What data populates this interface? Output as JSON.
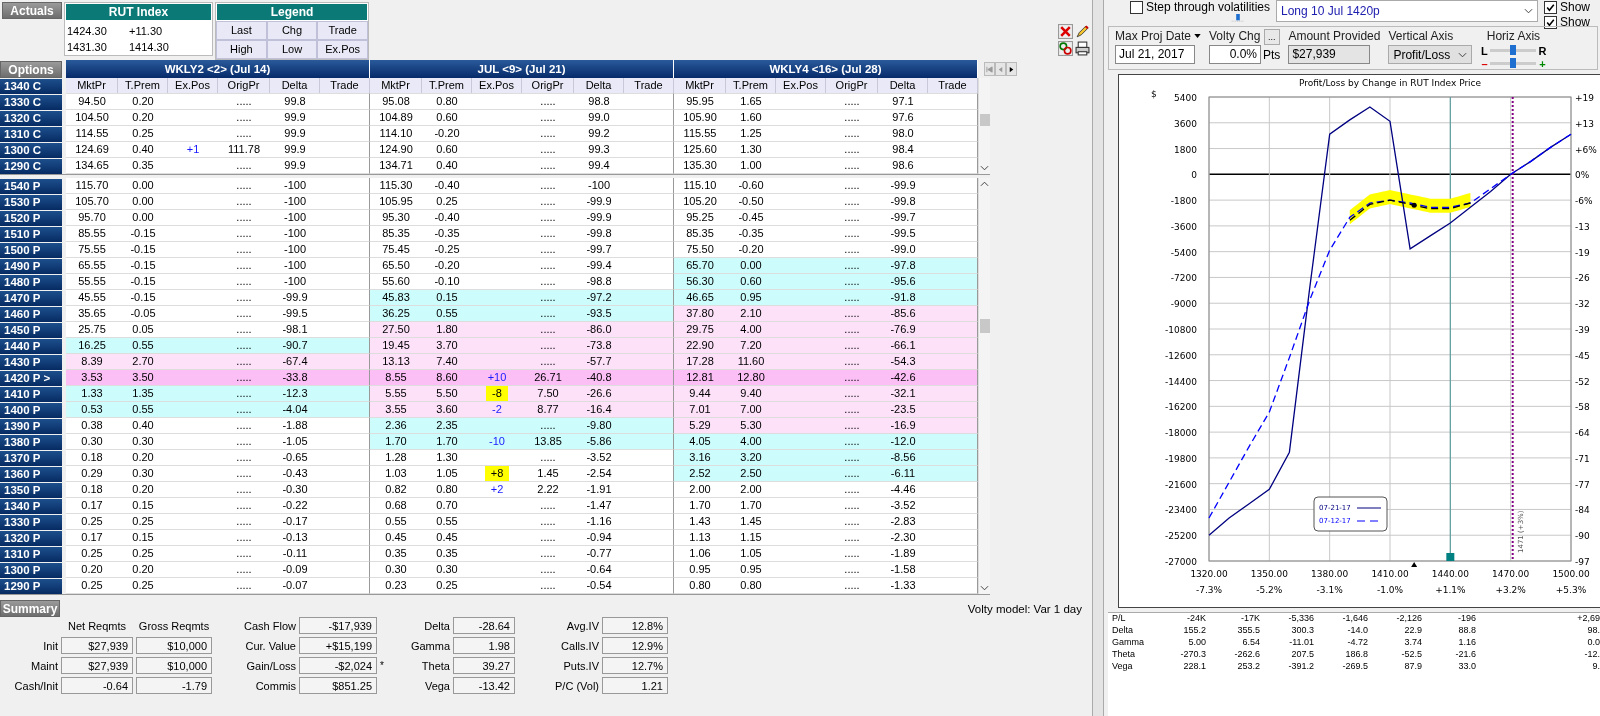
{
  "top_bar": {
    "actuals_button": "Actuals",
    "index": {
      "title": "RUT Index",
      "values": [
        "1424.30",
        "+11.30",
        "1431.30",
        "1414.30"
      ]
    },
    "legend": {
      "title": "Legend",
      "items": [
        "Last",
        "Chg",
        "Trade",
        "High",
        "Low",
        "Ex.Pos"
      ]
    }
  },
  "options_table": {
    "button": "Options",
    "groups": [
      {
        "title": "WKLY2 <2> (Jul 14)",
        "columns": [
          "MktPr",
          "T.Prem",
          "Ex.Pos",
          "OrigPr",
          "Delta",
          "Trade"
        ]
      },
      {
        "title": "JUL <9> (Jul 21)",
        "columns": [
          "MktPr",
          "T.Prem",
          "Ex.Pos",
          "OrigPr",
          "Delta",
          "Trade"
        ]
      },
      {
        "title": "WKLY4 <16> (Jul 28)",
        "columns": [
          "MktPr",
          "T.Prem",
          "Ex.Pos",
          "OrigPr",
          "Delta",
          "Trade"
        ]
      }
    ],
    "header_strike": "1340 C",
    "calls": [
      {
        "strike": "1330 C",
        "groups": [
          {
            "mkt": "94.50",
            "tp": "0.20",
            "orig": ".....",
            "delta": "99.8",
            "color": "#ffffff"
          },
          {
            "mkt": "95.08",
            "tp": "0.80",
            "orig": ".....",
            "delta": "98.8",
            "color": "#ffffff"
          },
          {
            "mkt": "95.95",
            "tp": "1.65",
            "orig": ".....",
            "delta": "97.1",
            "color": "#ffffff"
          }
        ]
      },
      {
        "strike": "1320 C",
        "groups": [
          {
            "mkt": "104.50",
            "tp": "0.20",
            "orig": ".....",
            "delta": "99.9",
            "color": "#ffffff"
          },
          {
            "mkt": "104.89",
            "tp": "0.60",
            "orig": ".....",
            "delta": "99.0",
            "color": "#ffffff"
          },
          {
            "mkt": "105.90",
            "tp": "1.60",
            "orig": ".....",
            "delta": "97.6",
            "color": "#ffffff"
          }
        ]
      },
      {
        "strike": "1310 C",
        "groups": [
          {
            "mkt": "114.55",
            "tp": "0.25",
            "orig": ".....",
            "delta": "99.9",
            "color": "#ffffff"
          },
          {
            "mkt": "114.10",
            "tp": "-0.20",
            "orig": ".....",
            "delta": "99.2",
            "color": "#ffffff"
          },
          {
            "mkt": "115.55",
            "tp": "1.25",
            "orig": ".....",
            "delta": "98.0",
            "color": "#ffffff"
          }
        ]
      },
      {
        "strike": "1300 C",
        "groups": [
          {
            "mkt": "124.69",
            "tp": "0.40",
            "ex": "+1",
            "marked": false,
            "orig": "111.78",
            "delta": "99.9",
            "color": "#ffffff"
          },
          {
            "mkt": "124.90",
            "tp": "0.60",
            "orig": ".....",
            "delta": "99.3",
            "color": "#ffffff"
          },
          {
            "mkt": "125.60",
            "tp": "1.30",
            "orig": ".....",
            "delta": "98.4",
            "color": "#ffffff"
          }
        ]
      },
      {
        "strike": "1290 C",
        "groups": [
          {
            "mkt": "134.65",
            "tp": "0.35",
            "orig": ".....",
            "delta": "99.9",
            "color": "#ffffff"
          },
          {
            "mkt": "134.71",
            "tp": "0.40",
            "orig": ".....",
            "delta": "99.4",
            "color": "#ffffff"
          },
          {
            "mkt": "135.30",
            "tp": "1.00",
            "orig": ".....",
            "delta": "98.6",
            "color": "#ffffff"
          }
        ]
      }
    ],
    "puts": [
      {
        "strike": "1540 P",
        "groups": [
          {
            "mkt": "115.70",
            "tp": "0.00",
            "orig": ".....",
            "delta": "-100",
            "color": "#ffffff"
          },
          {
            "mkt": "115.30",
            "tp": "-0.40",
            "orig": ".....",
            "delta": "-100",
            "color": "#ffffff"
          },
          {
            "mkt": "115.10",
            "tp": "-0.60",
            "orig": ".....",
            "delta": "-99.9",
            "color": "#ffffff"
          }
        ]
      },
      {
        "strike": "1530 P",
        "groups": [
          {
            "mkt": "105.70",
            "tp": "0.00",
            "orig": ".....",
            "delta": "-100",
            "color": "#ffffff"
          },
          {
            "mkt": "105.95",
            "tp": "0.25",
            "orig": ".....",
            "delta": "-99.9",
            "color": "#ffffff"
          },
          {
            "mkt": "105.20",
            "tp": "-0.50",
            "orig": ".....",
            "delta": "-99.8",
            "color": "#ffffff"
          }
        ]
      },
      {
        "strike": "1520 P",
        "groups": [
          {
            "mkt": "95.70",
            "tp": "0.00",
            "orig": ".....",
            "delta": "-100",
            "color": "#ffffff"
          },
          {
            "mkt": "95.30",
            "tp": "-0.40",
            "orig": ".....",
            "delta": "-99.9",
            "color": "#ffffff"
          },
          {
            "mkt": "95.25",
            "tp": "-0.45",
            "orig": ".....",
            "delta": "-99.7",
            "color": "#ffffff"
          }
        ]
      },
      {
        "strike": "1510 P",
        "groups": [
          {
            "mkt": "85.55",
            "tp": "-0.15",
            "orig": ".....",
            "delta": "-100",
            "color": "#ffffff"
          },
          {
            "mkt": "85.35",
            "tp": "-0.35",
            "orig": ".....",
            "delta": "-99.8",
            "color": "#ffffff"
          },
          {
            "mkt": "85.35",
            "tp": "-0.35",
            "orig": ".....",
            "delta": "-99.5",
            "color": "#ffffff"
          }
        ]
      },
      {
        "strike": "1500 P",
        "groups": [
          {
            "mkt": "75.55",
            "tp": "-0.15",
            "orig": ".....",
            "delta": "-100",
            "color": "#ffffff"
          },
          {
            "mkt": "75.45",
            "tp": "-0.25",
            "orig": ".....",
            "delta": "-99.7",
            "color": "#ffffff"
          },
          {
            "mkt": "75.50",
            "tp": "-0.20",
            "orig": ".....",
            "delta": "-99.0",
            "color": "#ffffff"
          }
        ]
      },
      {
        "strike": "1490 P",
        "groups": [
          {
            "mkt": "65.55",
            "tp": "-0.15",
            "orig": ".....",
            "delta": "-100",
            "color": "#ffffff"
          },
          {
            "mkt": "65.50",
            "tp": "-0.20",
            "orig": ".....",
            "delta": "-99.4",
            "color": "#ffffff"
          },
          {
            "mkt": "65.70",
            "tp": "0.00",
            "orig": ".....",
            "delta": "-97.8",
            "color": "#ccfcfc"
          }
        ]
      },
      {
        "strike": "1480 P",
        "groups": [
          {
            "mkt": "55.55",
            "tp": "-0.15",
            "orig": ".....",
            "delta": "-100",
            "color": "#ffffff"
          },
          {
            "mkt": "55.60",
            "tp": "-0.10",
            "orig": ".....",
            "delta": "-98.8",
            "color": "#ffffff"
          },
          {
            "mkt": "56.30",
            "tp": "0.60",
            "orig": ".....",
            "delta": "-95.6",
            "color": "#ccfcfc"
          }
        ]
      },
      {
        "strike": "1470 P",
        "groups": [
          {
            "mkt": "45.55",
            "tp": "-0.15",
            "orig": ".....",
            "delta": "-99.9",
            "color": "#ffffff"
          },
          {
            "mkt": "45.83",
            "tp": "0.15",
            "orig": ".....",
            "delta": "-97.2",
            "color": "#ccfcfc"
          },
          {
            "mkt": "46.65",
            "tp": "0.95",
            "orig": ".....",
            "delta": "-91.8",
            "color": "#ccfcfc"
          }
        ]
      },
      {
        "strike": "1460 P",
        "groups": [
          {
            "mkt": "35.65",
            "tp": "-0.05",
            "orig": ".....",
            "delta": "-99.5",
            "color": "#ffffff"
          },
          {
            "mkt": "36.25",
            "tp": "0.55",
            "orig": ".....",
            "delta": "-93.5",
            "color": "#ccfcfc"
          },
          {
            "mkt": "37.80",
            "tp": "2.10",
            "orig": ".....",
            "delta": "-85.6",
            "color": "#fde1f9"
          }
        ]
      },
      {
        "strike": "1450 P",
        "groups": [
          {
            "mkt": "25.75",
            "tp": "0.05",
            "orig": ".....",
            "delta": "-98.1",
            "color": "#ffffff"
          },
          {
            "mkt": "27.50",
            "tp": "1.80",
            "orig": ".....",
            "delta": "-86.0",
            "color": "#fde1f9"
          },
          {
            "mkt": "29.75",
            "tp": "4.00",
            "orig": ".....",
            "delta": "-76.9",
            "color": "#fde1f9"
          }
        ]
      },
      {
        "strike": "1440 P",
        "groups": [
          {
            "mkt": "16.25",
            "tp": "0.55",
            "orig": ".....",
            "delta": "-90.7",
            "color": "#ccfcfc"
          },
          {
            "mkt": "19.45",
            "tp": "3.70",
            "orig": ".....",
            "delta": "-73.8",
            "color": "#fde1f9"
          },
          {
            "mkt": "22.90",
            "tp": "7.20",
            "orig": ".....",
            "delta": "-66.1",
            "color": "#fde1f9"
          }
        ]
      },
      {
        "strike": "1430 P",
        "groups": [
          {
            "mkt": "8.39",
            "tp": "2.70",
            "orig": ".....",
            "delta": "-67.4",
            "color": "#fde1f9"
          },
          {
            "mkt": "13.13",
            "tp": "7.40",
            "orig": ".....",
            "delta": "-57.7",
            "color": "#fde1f9"
          },
          {
            "mkt": "17.28",
            "tp": "11.60",
            "orig": ".....",
            "delta": "-54.3",
            "color": "#fde1f9"
          }
        ]
      },
      {
        "strike": "1420 P >",
        "groups": [
          {
            "mkt": "3.53",
            "tp": "3.50",
            "orig": ".....",
            "delta": "-33.8",
            "color": "#fbbff5"
          },
          {
            "mkt": "8.55",
            "tp": "8.60",
            "ex": "+10",
            "marked": false,
            "orig": "26.71",
            "delta": "-40.8",
            "color": "#fbbff5"
          },
          {
            "mkt": "12.81",
            "tp": "12.80",
            "orig": ".....",
            "delta": "-42.6",
            "color": "#fbbff5"
          }
        ]
      },
      {
        "strike": "1410 P",
        "groups": [
          {
            "mkt": "1.33",
            "tp": "1.35",
            "orig": ".....",
            "delta": "-12.3",
            "color": "#ccfcfc"
          },
          {
            "mkt": "5.55",
            "tp": "5.50",
            "ex": "-8",
            "marked": true,
            "orig": "7.50",
            "delta": "-26.6",
            "color": "#fde1f9"
          },
          {
            "mkt": "9.44",
            "tp": "9.40",
            "orig": ".....",
            "delta": "-32.1",
            "color": "#fde1f9"
          }
        ]
      },
      {
        "strike": "1400 P",
        "groups": [
          {
            "mkt": "0.53",
            "tp": "0.55",
            "orig": ".....",
            "delta": "-4.04",
            "color": "#ccfcfc"
          },
          {
            "mkt": "3.55",
            "tp": "3.60",
            "ex": "-2",
            "marked": false,
            "orig": "8.77",
            "delta": "-16.4",
            "color": "#fde1f9"
          },
          {
            "mkt": "7.01",
            "tp": "7.00",
            "orig": ".....",
            "delta": "-23.5",
            "color": "#fde1f9"
          }
        ]
      },
      {
        "strike": "1390 P",
        "groups": [
          {
            "mkt": "0.38",
            "tp": "0.40",
            "orig": ".....",
            "delta": "-1.88",
            "color": "#ffffff"
          },
          {
            "mkt": "2.36",
            "tp": "2.35",
            "orig": ".....",
            "delta": "-9.80",
            "color": "#ccfcfc"
          },
          {
            "mkt": "5.29",
            "tp": "5.30",
            "orig": ".....",
            "delta": "-16.9",
            "color": "#fde1f9"
          }
        ]
      },
      {
        "strike": "1380 P",
        "groups": [
          {
            "mkt": "0.30",
            "tp": "0.30",
            "orig": ".....",
            "delta": "-1.05",
            "color": "#ffffff"
          },
          {
            "mkt": "1.70",
            "tp": "1.70",
            "ex": "-10",
            "marked": false,
            "orig": "13.85",
            "delta": "-5.86",
            "color": "#ccfcfc"
          },
          {
            "mkt": "4.05",
            "tp": "4.00",
            "orig": ".....",
            "delta": "-12.0",
            "color": "#ccfcfc"
          }
        ]
      },
      {
        "strike": "1370 P",
        "groups": [
          {
            "mkt": "0.18",
            "tp": "0.20",
            "orig": ".....",
            "delta": "-0.65",
            "color": "#ffffff"
          },
          {
            "mkt": "1.28",
            "tp": "1.30",
            "orig": ".....",
            "delta": "-3.52",
            "color": "#ffffff"
          },
          {
            "mkt": "3.16",
            "tp": "3.20",
            "orig": ".....",
            "delta": "-8.56",
            "color": "#ccfcfc"
          }
        ]
      },
      {
        "strike": "1360 P",
        "groups": [
          {
            "mkt": "0.29",
            "tp": "0.30",
            "orig": ".....",
            "delta": "-0.43",
            "color": "#ffffff"
          },
          {
            "mkt": "1.03",
            "tp": "1.05",
            "ex": "+8",
            "marked": true,
            "orig": "1.45",
            "delta": "-2.54",
            "color": "#ffffff"
          },
          {
            "mkt": "2.52",
            "tp": "2.50",
            "orig": ".....",
            "delta": "-6.11",
            "color": "#ccfcfc"
          }
        ]
      },
      {
        "strike": "1350 P",
        "groups": [
          {
            "mkt": "0.18",
            "tp": "0.20",
            "orig": ".....",
            "delta": "-0.30",
            "color": "#ffffff"
          },
          {
            "mkt": "0.82",
            "tp": "0.80",
            "ex": "+2",
            "marked": false,
            "orig": "2.22",
            "delta": "-1.91",
            "color": "#ffffff"
          },
          {
            "mkt": "2.00",
            "tp": "2.00",
            "orig": ".....",
            "delta": "-4.46",
            "color": "#ffffff"
          }
        ]
      },
      {
        "strike": "1340 P",
        "groups": [
          {
            "mkt": "0.17",
            "tp": "0.15",
            "orig": ".....",
            "delta": "-0.22",
            "color": "#ffffff"
          },
          {
            "mkt": "0.68",
            "tp": "0.70",
            "orig": ".....",
            "delta": "-1.47",
            "color": "#ffffff"
          },
          {
            "mkt": "1.70",
            "tp": "1.70",
            "orig": ".....",
            "delta": "-3.52",
            "color": "#ffffff"
          }
        ]
      },
      {
        "strike": "1330 P",
        "groups": [
          {
            "mkt": "0.25",
            "tp": "0.25",
            "orig": ".....",
            "delta": "-0.17",
            "color": "#ffffff"
          },
          {
            "mkt": "0.55",
            "tp": "0.55",
            "orig": ".....",
            "delta": "-1.16",
            "color": "#ffffff"
          },
          {
            "mkt": "1.43",
            "tp": "1.45",
            "orig": ".....",
            "delta": "-2.83",
            "color": "#ffffff"
          }
        ]
      },
      {
        "strike": "1320 P",
        "groups": [
          {
            "mkt": "0.17",
            "tp": "0.15",
            "orig": ".....",
            "delta": "-0.13",
            "color": "#ffffff"
          },
          {
            "mkt": "0.45",
            "tp": "0.45",
            "orig": ".....",
            "delta": "-0.94",
            "color": "#ffffff"
          },
          {
            "mkt": "1.13",
            "tp": "1.15",
            "orig": ".....",
            "delta": "-2.30",
            "color": "#ffffff"
          }
        ]
      },
      {
        "strike": "1310 P",
        "groups": [
          {
            "mkt": "0.25",
            "tp": "0.25",
            "orig": ".....",
            "delta": "-0.11",
            "color": "#ffffff"
          },
          {
            "mkt": "0.35",
            "tp": "0.35",
            "orig": ".....",
            "delta": "-0.77",
            "color": "#ffffff"
          },
          {
            "mkt": "1.06",
            "tp": "1.05",
            "orig": ".....",
            "delta": "-1.89",
            "color": "#ffffff"
          }
        ]
      },
      {
        "strike": "1300 P",
        "groups": [
          {
            "mkt": "0.20",
            "tp": "0.20",
            "orig": ".....",
            "delta": "-0.09",
            "color": "#ffffff"
          },
          {
            "mkt": "0.30",
            "tp": "0.30",
            "orig": ".....",
            "delta": "-0.64",
            "color": "#ffffff"
          },
          {
            "mkt": "0.95",
            "tp": "0.95",
            "orig": ".....",
            "delta": "-1.58",
            "color": "#ffffff"
          }
        ]
      },
      {
        "strike": "1290 P",
        "groups": [
          {
            "mkt": "0.25",
            "tp": "0.25",
            "orig": ".....",
            "delta": "-0.07",
            "color": "#ffffff"
          },
          {
            "mkt": "0.23",
            "tp": "0.25",
            "orig": ".....",
            "delta": "-0.54",
            "color": "#ffffff"
          },
          {
            "mkt": "0.80",
            "tp": "0.80",
            "orig": ".....",
            "delta": "-1.33",
            "color": "#ffffff"
          }
        ]
      }
    ]
  },
  "volty_model": "Volty model: Var 1 day",
  "summary": {
    "button": "Summary",
    "requirements": {
      "columns": [
        "Net Reqmts",
        "Gross Reqmts"
      ],
      "rows": [
        {
          "label": "Init",
          "values": [
            "$27,939",
            "$10,000"
          ]
        },
        {
          "label": "Maint",
          "values": [
            "$27,939",
            "$10,000"
          ]
        },
        {
          "label": "Cash/Init",
          "values": [
            "-0.64",
            "-1.79"
          ]
        }
      ]
    },
    "cash": [
      {
        "label": "Cash Flow",
        "value": "-$17,939"
      },
      {
        "label": "Cur. Value",
        "value": "+$15,199"
      },
      {
        "label": "Gain/Loss",
        "value": "-$2,024",
        "note": "*"
      },
      {
        "label": "Commis",
        "value": "$851.25"
      }
    ],
    "greeks": [
      {
        "label": "Delta",
        "value": "-28.64"
      },
      {
        "label": "Gamma",
        "value": "1.98"
      },
      {
        "label": "Theta",
        "value": "39.27"
      },
      {
        "label": "Vega",
        "value": "-13.42"
      }
    ],
    "volatility": [
      {
        "label": "Avg.IV",
        "value": "12.8%"
      },
      {
        "label": "Calls.IV",
        "value": "12.9%"
      },
      {
        "label": "Puts.IV",
        "value": "12.7%"
      },
      {
        "label": "P/C (Vol)",
        "value": "1.21"
      }
    ]
  },
  "right_panel": {
    "step_volatilities": {
      "label": "Step through volatilities",
      "checked": false
    },
    "positions_text": "Long 10 Jul 1420p",
    "show_checks": [
      {
        "label": "Show",
        "checked": true
      },
      {
        "label": "Show",
        "checked": true
      }
    ],
    "controls": {
      "max_proj_date": {
        "label": "Max Proj Date",
        "value": "Jul 21, 2017"
      },
      "volty_chg": {
        "label": "Volty Chg",
        "value": "0.0%",
        "button": "...",
        "unit": "Pts"
      },
      "amount_provided": {
        "label": "Amount Provided",
        "value": "$27,939"
      },
      "vertical_axis": {
        "label": "Vertical Axis",
        "value": "Profit/Loss"
      },
      "horiz_axis": {
        "label": "Horiz Axis",
        "sliders": [
          {
            "left": "L",
            "right": "R",
            "tinted": false,
            "level": 0.5
          },
          {
            "left": "–",
            "right": "+",
            "tinted": true,
            "level": 0.5
          }
        ]
      }
    }
  },
  "chart": {
    "chart_data": {
      "type": "line",
      "title": "Profit/Loss by Change in RUT Index Price",
      "ylabel": "$",
      "x": [
        1320,
        1330,
        1340,
        1350,
        1360,
        1370,
        1380,
        1390,
        1400,
        1410,
        1420,
        1430,
        1440,
        1450,
        1460,
        1470,
        1480,
        1490,
        1500
      ],
      "series": [
        {
          "name": "07-21-17",
          "color": "#000080",
          "line_style": "solid",
          "values": [
            -25200,
            -24000,
            -23000,
            -22000,
            -19400,
            -8000,
            2800,
            3800,
            4700,
            3700,
            -5200,
            -4300,
            -3400,
            -2300,
            -1200,
            0,
            900,
            1900,
            2800
          ]
        },
        {
          "name": "07-12-17",
          "color": "#0000ff",
          "line_style": "dashed",
          "values": [
            -24000,
            -21500,
            -19000,
            -16600,
            -12800,
            -8800,
            -5300,
            -3000,
            -2000,
            -1800,
            -2000,
            -2300,
            -2300,
            -2000,
            -1000,
            0,
            900,
            1900,
            2800
          ]
        },
        {
          "color": "#000000",
          "line_style": "dashed",
          "values": [
            null,
            null,
            null,
            null,
            null,
            null,
            null,
            -3200,
            -2100,
            -1800,
            -2100,
            -2400,
            -2400,
            -2000,
            null,
            null,
            null,
            null,
            null
          ]
        }
      ],
      "xlim": [
        1320,
        1500
      ],
      "ylim": [
        -27000,
        5400
      ],
      "xticks": [
        {
          "value": 1320,
          "label": "1320.00"
        },
        {
          "value": 1350,
          "label": "1350.00"
        },
        {
          "value": 1380,
          "label": "1380.00"
        },
        {
          "value": 1410,
          "label": "1410.00"
        },
        {
          "value": 1440,
          "label": "1440.00"
        },
        {
          "value": 1470,
          "label": "1470.00"
        },
        {
          "value": 1500,
          "label": "1500.00"
        }
      ],
      "yticks": [
        5400,
        3600,
        1800,
        0,
        -1800,
        -3600,
        -5400,
        -7200,
        -9000,
        -10800,
        -12600,
        -14400,
        -16200,
        -18000,
        -19800,
        -21600,
        -23400,
        -25200,
        -27000
      ],
      "grid": true,
      "legend": "lower center",
      "ref_lines": [
        {
          "axis": "x",
          "value": 1440,
          "color": "#5f9ea0",
          "line_style": "solid"
        },
        {
          "axis": "x",
          "value": 1471,
          "color": "#800080",
          "line_style": "dotted",
          "label": "1471 (+3%)"
        }
      ]
    },
    "percent_xlabels": [
      "-7.3%",
      "-5.2%",
      "-3.1%",
      "-1.0%",
      "+1.1%",
      "+3.2%",
      "+5.3%"
    ],
    "percent_ylabels": [
      "+19",
      "+13",
      "+6%",
      "0%",
      "-6%",
      "-13",
      "-19",
      "-26",
      "-32",
      "-39",
      "-45",
      "-52",
      "-58",
      "-64",
      "-71",
      "-77",
      "-84",
      "-90",
      "-97"
    ]
  },
  "greeks_table": {
    "rows": [
      {
        "label": "P/L",
        "values": [
          "-24K",
          "-17K",
          "-5,336",
          "-1,646",
          "-2,126",
          "-196",
          "+2,69"
        ]
      },
      {
        "label": "Delta",
        "values": [
          "155.2",
          "355.5",
          "300.3",
          "-14.0",
          "22.9",
          "88.8",
          "98."
        ]
      },
      {
        "label": "Gamma",
        "values": [
          "5.00",
          "6.54",
          "-11.01",
          "-4.72",
          "3.74",
          "1.16",
          "0.0"
        ]
      },
      {
        "label": "Theta",
        "values": [
          "-270.3",
          "-262.6",
          "207.5",
          "186.8",
          "-52.5",
          "-21.6",
          "-12."
        ]
      },
      {
        "label": "Vega",
        "values": [
          "228.1",
          "253.2",
          "-391.2",
          "-269.5",
          "87.9",
          "33.0",
          "9."
        ]
      }
    ]
  }
}
